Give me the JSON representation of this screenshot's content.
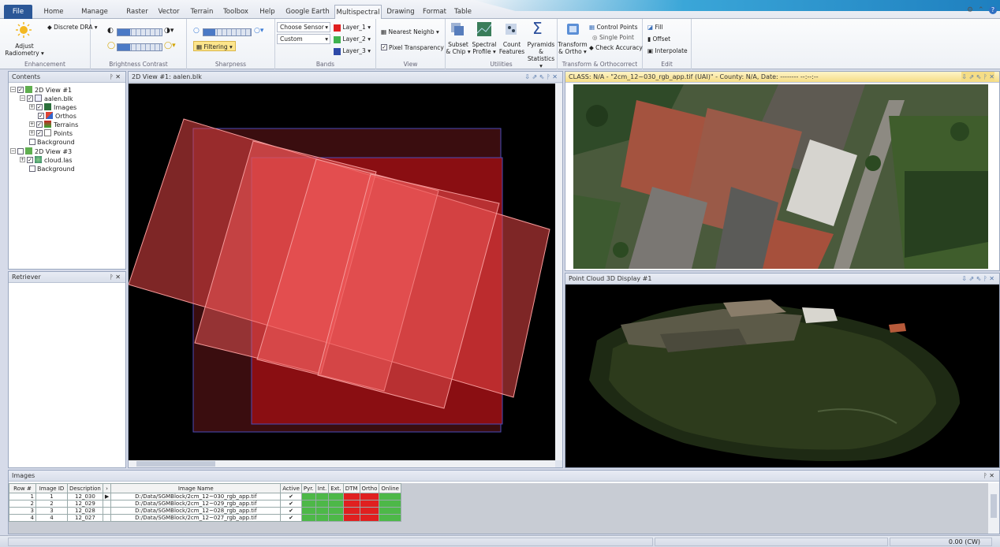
{
  "tabs": [
    "File",
    "Home",
    "Manage Data",
    "Raster",
    "Vector",
    "Terrain",
    "Toolbox",
    "Help",
    "Google Earth",
    "Multispectral",
    "Drawing",
    "Format",
    "Table"
  ],
  "ribbon": {
    "enhancement": {
      "adjust": "Adjust",
      "radiometry": "Radiometry",
      "dra": "Discrete DRA",
      "caption": "Enhancement"
    },
    "brightness": {
      "caption": "Brightness Contrast"
    },
    "sharpness": {
      "filtering": "Filtering",
      "caption": "Sharpness"
    },
    "bands": {
      "sensor": "Choose Sensor",
      "custom": "Custom",
      "layer1": "Layer_1",
      "layer2": "Layer_2",
      "layer3": "Layer_3",
      "caption": "Bands",
      "layer_colors": [
        "#e02020",
        "#3fb34f",
        "#2e4aa8"
      ]
    },
    "view": {
      "resample": "Nearest Neighb",
      "pixel_transparency": "Pixel Transparency",
      "caption": "View"
    },
    "utilities": {
      "subset1": "Subset",
      "subset2": "& Chip",
      "spectral1": "Spectral",
      "spectral2": "Profile",
      "count1": "Count",
      "count2": "Features",
      "pyramids1": "Pyramids &",
      "pyramids2": "Statistics",
      "caption": "Utilities"
    },
    "transform": {
      "t1": "Transform",
      "t2": "& Ortho",
      "control_points": "Control Points",
      "single_point": "Single Point",
      "check_accuracy": "Check Accuracy",
      "caption": "Transform & Orthocorrect"
    },
    "edit": {
      "fill": "Fill",
      "offset": "Offset",
      "interpolate": "Interpolate",
      "caption": "Edit"
    }
  },
  "contents": {
    "title": "Contents",
    "view1": "2D View #1",
    "aalen": "aalen.blk",
    "images": "Images",
    "orthos": "Orthos",
    "terrains": "Terrains",
    "points": "Points",
    "background": "Background",
    "view3": "2D View #3",
    "cloud": "cloud.las",
    "background2": "Background"
  },
  "retriever": {
    "title": "Retriever"
  },
  "view2d": {
    "title": "2D View #1: aalen.blk"
  },
  "classview": {
    "title": "CLASS: N/A - \"2cm_12~030_rgb_app.tif (UAI)\" - County: N/A, Date: -------- --:--:--"
  },
  "pointcloud": {
    "title": "Point Cloud 3D Display #1"
  },
  "imagesPanel": {
    "title": "Images",
    "headers": [
      "Row #",
      "Image ID",
      "Description",
      "",
      "Image Name",
      "Active",
      "Pyr.",
      "Int.",
      "Ext.",
      "DTM",
      "Ortho",
      "Online"
    ],
    "rows": [
      {
        "row": "1",
        "id": "1",
        "desc": "12_030",
        "name": "D:/Data/SGMBlock/2cm_12~030_rgb_app.tif"
      },
      {
        "row": "2",
        "id": "2",
        "desc": "12_029",
        "name": "D:/Data/SGMBlock/2cm_12~029_rgb_app.tif"
      },
      {
        "row": "3",
        "id": "3",
        "desc": "12_028",
        "name": "D:/Data/SGMBlock/2cm_12~028_rgb_app.tif"
      },
      {
        "row": "4",
        "id": "4",
        "desc": "12_027",
        "name": "D:/Data/SGMBlock/2cm_12~027_rgb_app.tif"
      }
    ]
  },
  "status": {
    "rotation": "0.00 (CW)"
  }
}
